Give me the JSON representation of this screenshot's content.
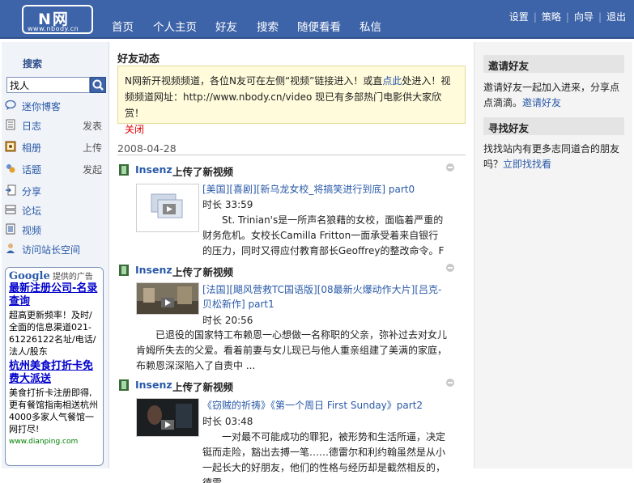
{
  "logo": {
    "text": "N网",
    "url_text": "www.nbody.cn"
  },
  "nav": {
    "items": [
      "首页",
      "个人主页",
      "好友",
      "搜索",
      "随便看看",
      "私信"
    ]
  },
  "top_links": [
    "设置",
    "策略",
    "向导",
    "退出"
  ],
  "sidebar": {
    "search_title": "搜索",
    "search_value": "找人",
    "items": [
      {
        "label": "迷你博客",
        "action": "",
        "icon": "mini-blog-icon"
      },
      {
        "label": "日志",
        "action": "发表",
        "icon": "journal-icon"
      },
      {
        "label": "相册",
        "action": "上传",
        "icon": "photo-album-icon"
      },
      {
        "label": "话题",
        "action": "发起",
        "icon": "topic-icon"
      },
      {
        "label": "分享",
        "action": "",
        "icon": "share-icon"
      },
      {
        "label": "论坛",
        "action": "",
        "icon": "forum-icon"
      },
      {
        "label": "视频",
        "action": "",
        "icon": "video-icon"
      },
      {
        "label": "访问站长空间",
        "action": "",
        "icon": "user-icon"
      }
    ]
  },
  "google_ad": {
    "brand": "Google",
    "header": "提供的广告",
    "ads": [
      {
        "title": "最新注册公司-名录查询",
        "body": "超高更新频率！及时/全面的信息渠道021-61226122名址/电话/法人/股东"
      },
      {
        "title": "杭州美食打折卡免费大派送",
        "body": "美食打折卡注册即得,更有餐馆指南相送杭州4000多家人气餐馆一网打尽!"
      }
    ],
    "footer_url": "www.dianping.com"
  },
  "main": {
    "title": "好友动态",
    "notice": {
      "text1": "N网新开视频频道，各位N友可在左侧“视频”链接进入！或直",
      "link": "点此",
      "text2": "处进入！视频频道网址：http://www.nbody.cn/video 现已有多部热门电影供大家欣赏！",
      "close": "关闭"
    },
    "date": "2008-04-28",
    "feeds": [
      {
        "user": "Insenz",
        "action": "上传了新视频",
        "title": "[美国][喜剧][新乌龙女校_将搞笑进行到底] part0",
        "duration": "时长 33:59",
        "description": "　　St. Trinian's是一所声名狼藉的女校，面临着严重的财务危机。女校长Camilla Fritton一面承受着来自银行的压力，同时又得应付教育部长Geoffrey的整改命令。F ...",
        "thumb_style": "placeholder"
      },
      {
        "user": "Insenz",
        "action": "上传了新视频",
        "title": "[法国][飓风营救TC国语版][08最新火爆动作大片][吕克-贝松新作] part1",
        "duration": "时长 20:56",
        "description": "　　已退役的国家特工布赖恩一心想做一名称职的父亲，弥补过去对女儿肯姆所失去的父爱。看着前妻与女儿现已与他人重亲组建了美满的家庭，布赖恩深深陷入了自责中 ...",
        "thumb_style": "street"
      },
      {
        "user": "Insenz",
        "action": "上传了新视频",
        "title": "《窃贼的祈祷》《第一个周日 First Sunday》part2",
        "duration": "时长 03:48",
        "description": "　　一对最不可能成功的罪犯，被形势和生活所逼，决定铤而走险，豁出去搏一笔……德雷尔和利约翰虽然是从小一起长大的好朋友，他们的性格与经历却是截然相反的，德雷 ...",
        "thumb_style": "dark"
      }
    ]
  },
  "right": {
    "invite_title": "邀请好友",
    "invite_text": "邀请好友一起加入进来，分享点点滴滴。",
    "invite_link": "邀请好友",
    "find_title": "寻找好友",
    "find_text": "找找站内有更多志同道合的朋友吗？",
    "find_link": "立即找找看"
  },
  "colors": {
    "header_bg": "#3d63a8",
    "link": "#2a5aa8",
    "notice_bg": "#fffbdb",
    "ad_title": "#0000cc"
  }
}
